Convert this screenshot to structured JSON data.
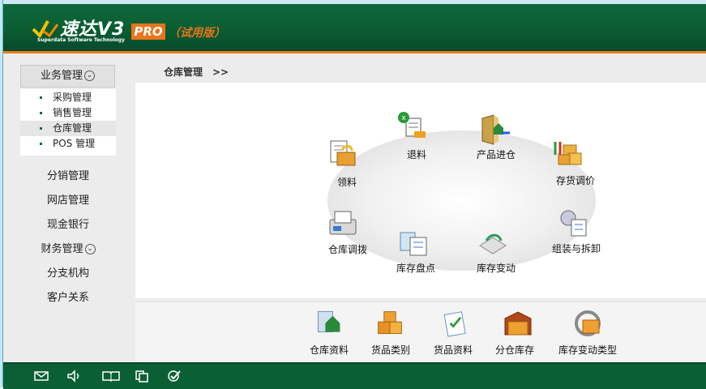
{
  "header": {
    "app_title": "速达V3",
    "company": "Superdata Software Technology",
    "edition": "PRO",
    "edition_note": "（试用版）"
  },
  "sidebar": {
    "section_title": "业务管理",
    "sub_items": [
      {
        "label": "采购管理"
      },
      {
        "label": "销售管理"
      },
      {
        "label": "仓库管理",
        "active": true
      },
      {
        "label": "POS 管理"
      }
    ],
    "links": [
      "分销管理",
      "网店管理",
      "现金银行",
      "财务管理",
      "分支机构",
      "客户关系"
    ]
  },
  "breadcrumb": "仓库管理　>>",
  "workflow": {
    "nodes": [
      {
        "label": "退料",
        "icon": "return-materials-icon"
      },
      {
        "label": "产品进仓",
        "icon": "product-warehousing-icon"
      },
      {
        "label": "领料",
        "icon": "material-requisition-icon"
      },
      {
        "label": "存货调价",
        "icon": "inventory-price-adjust-icon"
      },
      {
        "label": "仓库调拨",
        "icon": "warehouse-transfer-icon"
      },
      {
        "label": "库存盘点",
        "icon": "stock-count-icon"
      },
      {
        "label": "库存变动",
        "icon": "stock-change-icon"
      },
      {
        "label": "组装与拆卸",
        "icon": "assembly-disassembly-icon"
      }
    ]
  },
  "bottom_items": [
    {
      "label": "仓库资料",
      "icon": "warehouse-data-icon"
    },
    {
      "label": "货品类别",
      "icon": "goods-category-icon"
    },
    {
      "label": "货品资料",
      "icon": "goods-data-icon"
    },
    {
      "label": "分仓库存",
      "icon": "branch-stock-icon"
    },
    {
      "label": "库存变动类型",
      "icon": "stock-change-type-icon"
    }
  ],
  "statusbar": {
    "icons": [
      "mail-icon",
      "speaker-icon",
      "book-icon",
      "copy-icon",
      "check-icon"
    ]
  },
  "colors": {
    "header_green": "#0a5a31",
    "accent_orange": "#e8751a",
    "status_green": "#0b5f35"
  }
}
